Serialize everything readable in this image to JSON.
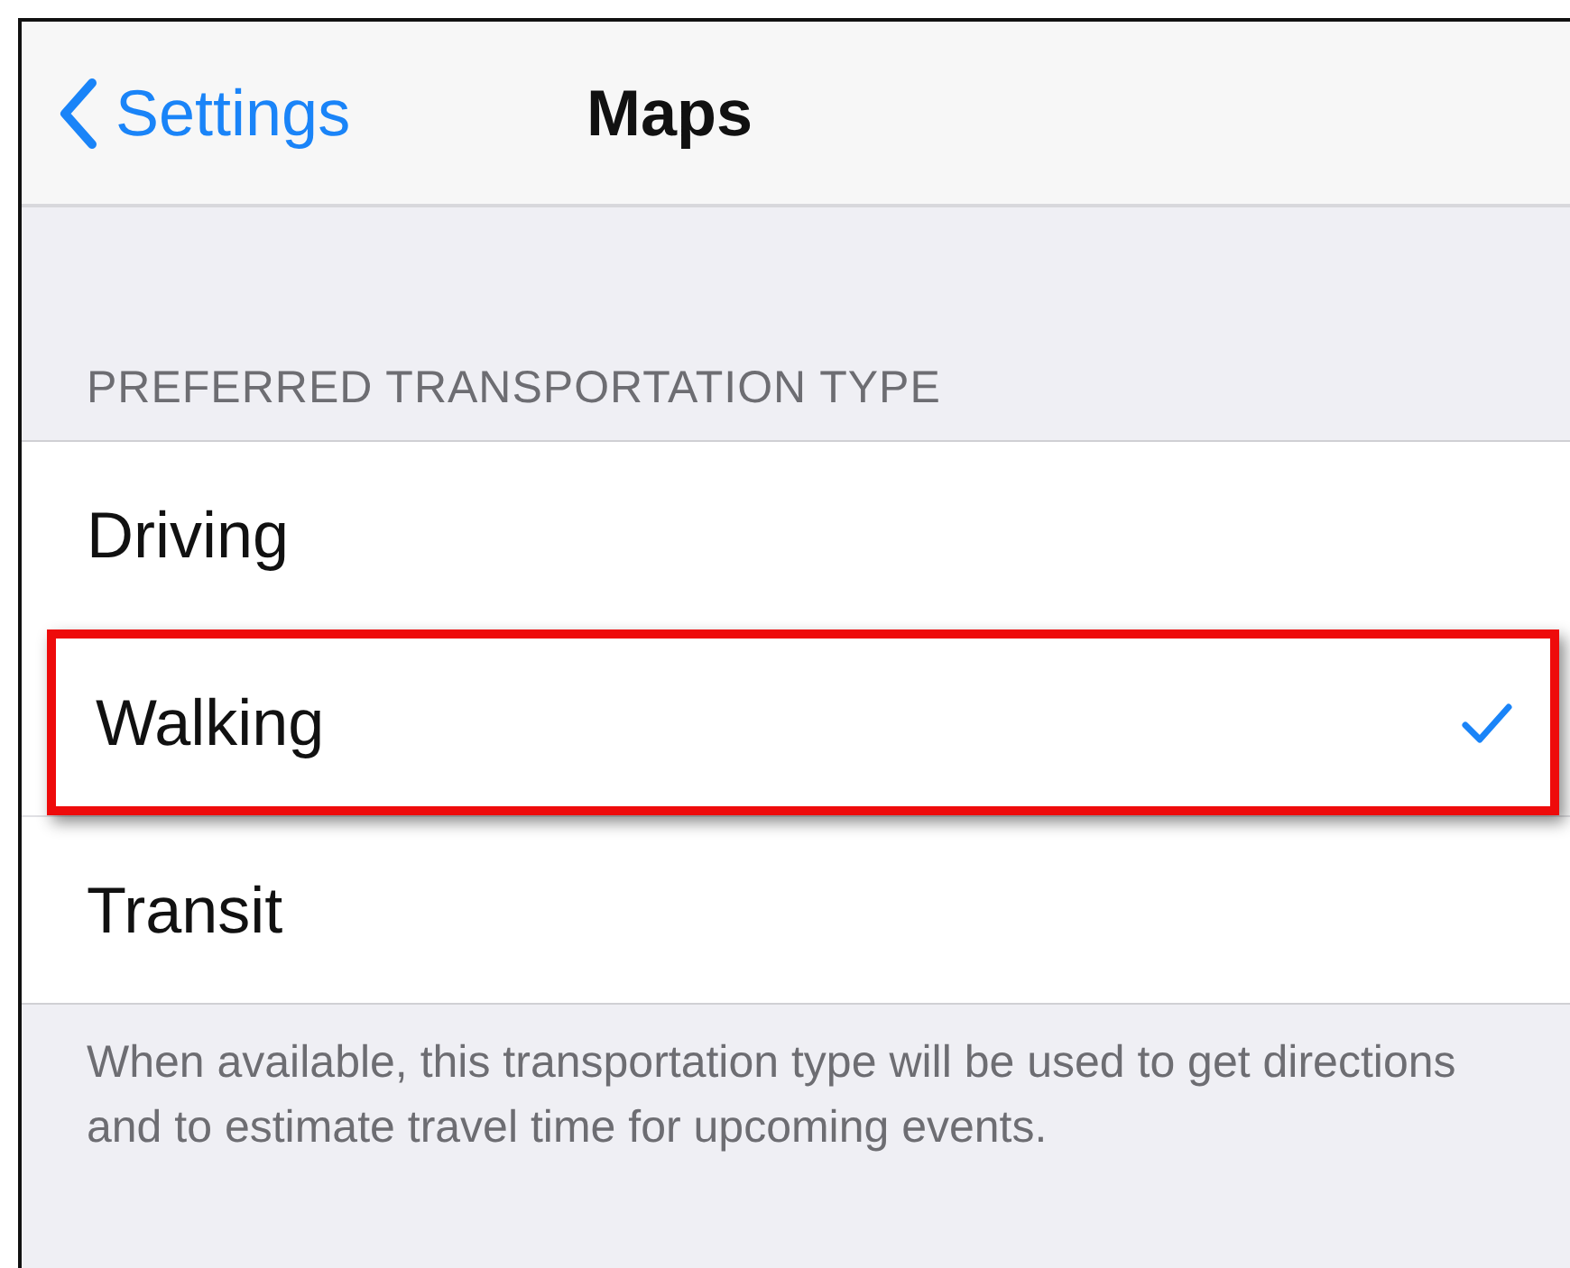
{
  "nav_bar": {
    "back_label": "Settings",
    "title": "Maps"
  },
  "section": {
    "header": "PREFERRED TRANSPORTATION TYPE",
    "options": [
      {
        "label": "Driving",
        "selected": false,
        "highlighted": false
      },
      {
        "label": "Walking",
        "selected": true,
        "highlighted": true
      },
      {
        "label": "Transit",
        "selected": false,
        "highlighted": false
      }
    ],
    "footer": "When available, this transportation type will be used to get directions and to estimate travel time for upcoming events."
  }
}
